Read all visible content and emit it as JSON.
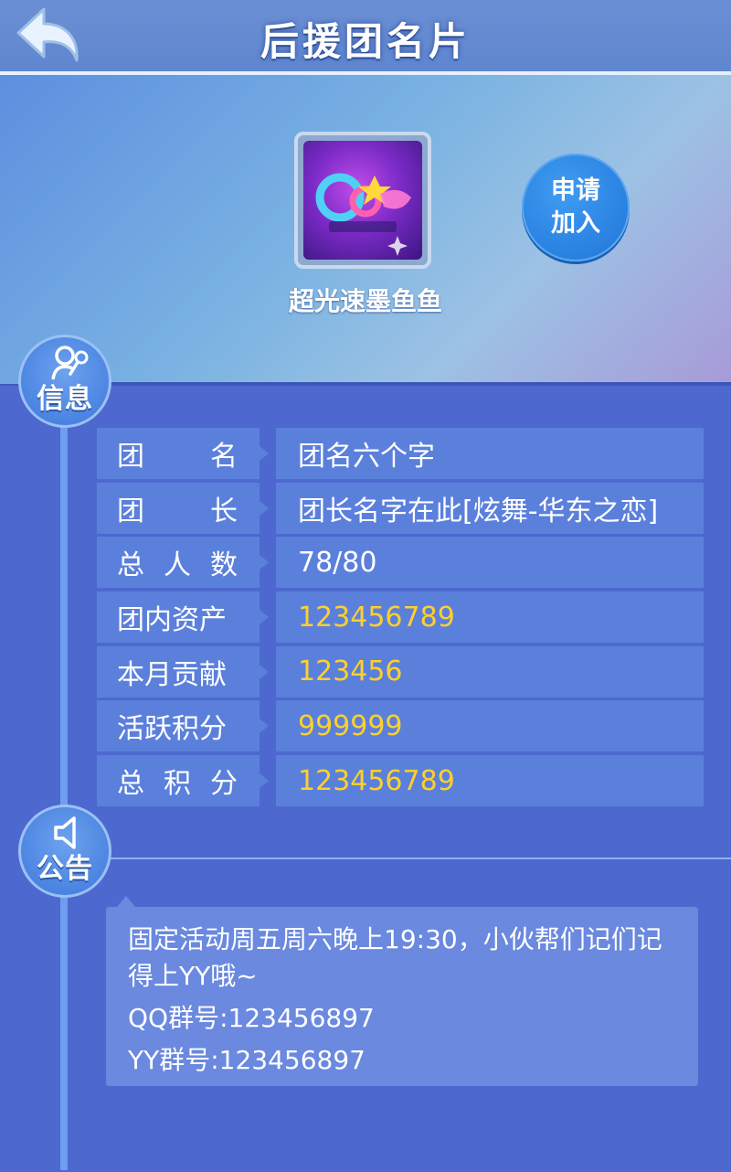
{
  "header": {
    "title": "后援团名片"
  },
  "team": {
    "name": "超光速墨鱼鱼",
    "logo_alt": "QQ炫舞",
    "join_line1": "申请",
    "join_line2": "加入"
  },
  "sections": {
    "info": "信息",
    "notice": "公告"
  },
  "info_rows": [
    {
      "label_parts": [
        "团",
        "名"
      ],
      "value": "团名六个字",
      "value_color": "white"
    },
    {
      "label_parts": [
        "团",
        "长"
      ],
      "value": "团长名字在此[炫舞-华东之恋]",
      "value_color": "white"
    },
    {
      "label_parts": [
        "总",
        "人",
        "数"
      ],
      "value": "78/80",
      "value_color": "white"
    },
    {
      "label": "团内资产",
      "value": "123456789",
      "value_color": "#ffd02a"
    },
    {
      "label": "本月贡献",
      "value": "123456",
      "value_color": "#ffd02a"
    },
    {
      "label": "活跃积分",
      "value": "999999",
      "value_color": "#ffd02a"
    },
    {
      "label_parts": [
        "总",
        "积",
        "分"
      ],
      "value": "123456789",
      "value_color": "#ffd02a"
    }
  ],
  "notice": {
    "line1": "固定活动周五周六晚上19:30，小伙帮们记们记得上YY哦~",
    "line2": "QQ群号:123456897",
    "line3": "YY群号:123456897"
  },
  "icons": {
    "back": "back-arrow-icon",
    "info": "user-microphone-icon",
    "notice": "speaker-icon"
  },
  "colors": {
    "accent": "#1f74d8",
    "highlight": "#ffd02a",
    "panel": "#5b80dc",
    "background": "#4d68cf"
  }
}
